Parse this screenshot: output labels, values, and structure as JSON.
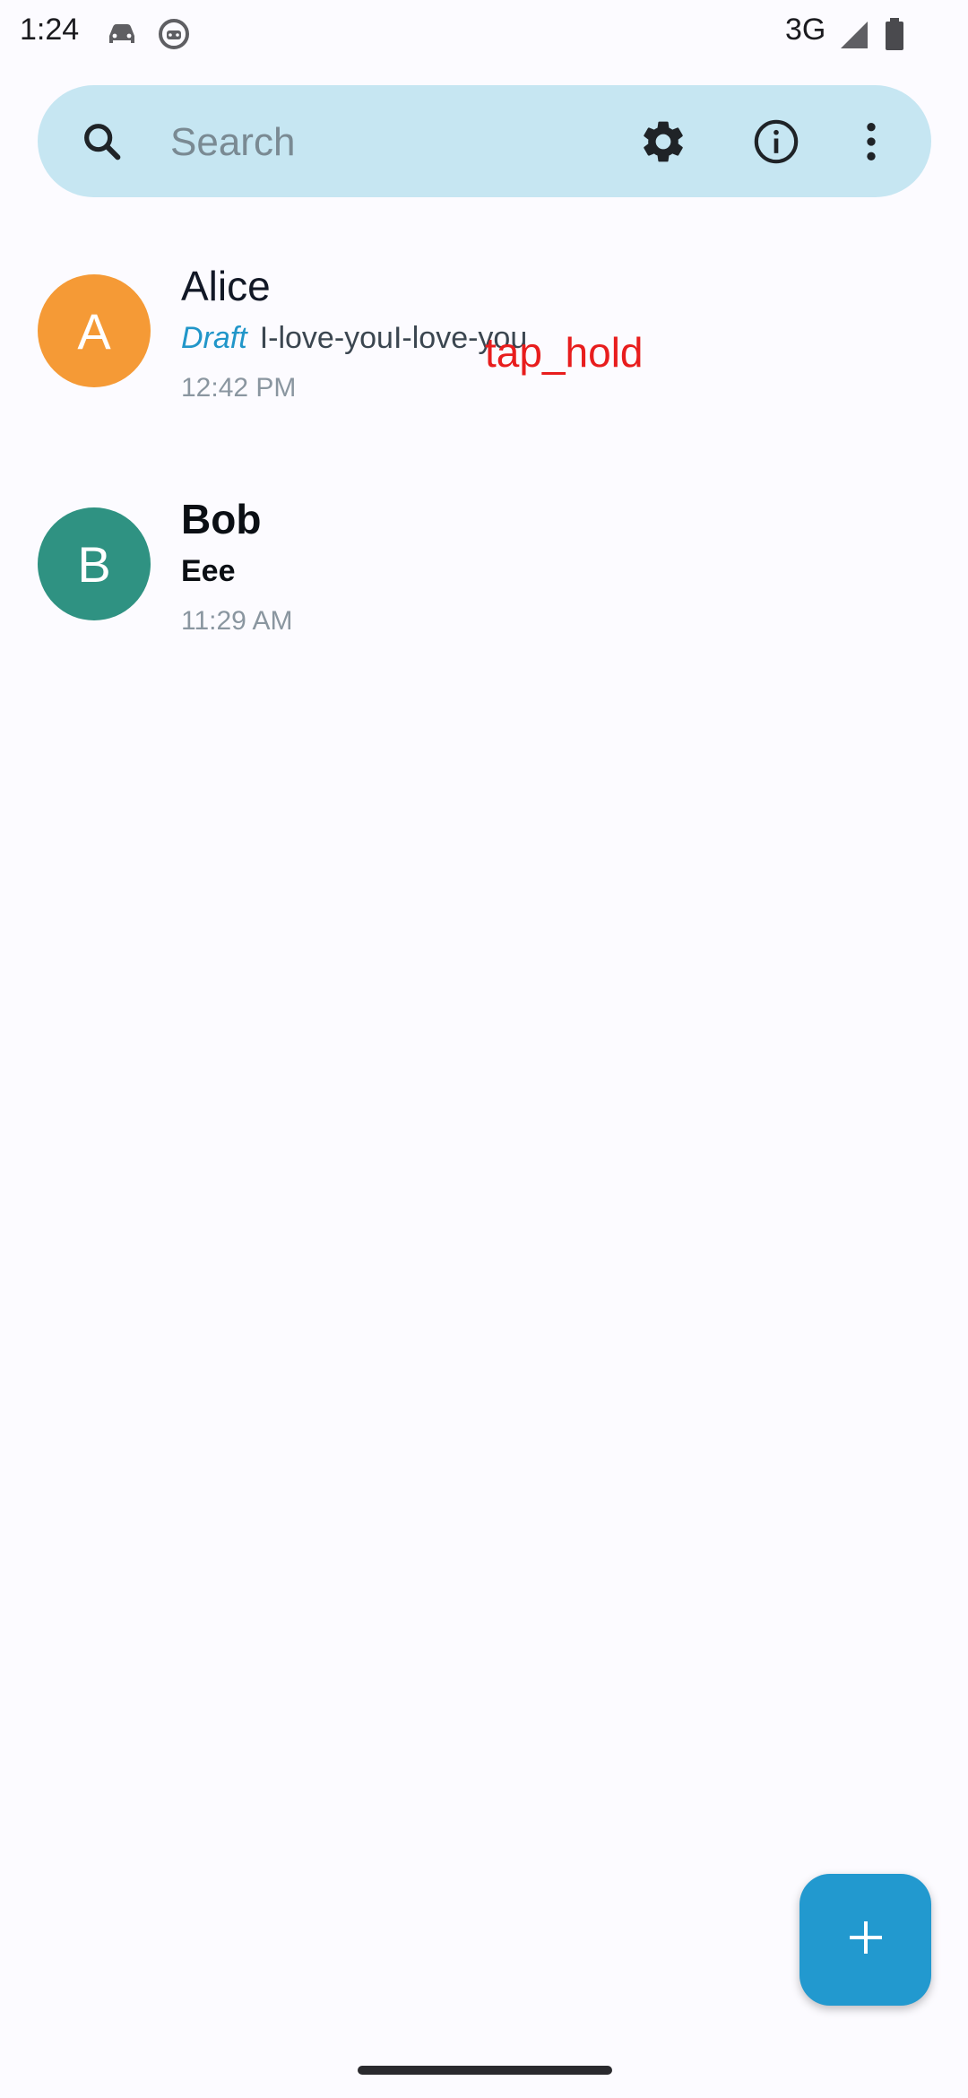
{
  "status_bar": {
    "time": "1:24",
    "network": "3G",
    "icons": [
      "car-icon",
      "android-icon",
      "signal-icon",
      "battery-icon"
    ]
  },
  "search": {
    "placeholder": "Search",
    "icons": [
      "search-icon",
      "settings-gear-icon",
      "info-icon",
      "more-vert-icon"
    ]
  },
  "conversations": [
    {
      "avatar_letter": "A",
      "avatar_color": "#f59a36",
      "name": "Alice",
      "draft_label": "Draft",
      "snippet": "I-love-youI-love-you",
      "time": "12:42 PM",
      "unread": false
    },
    {
      "avatar_letter": "B",
      "avatar_color": "#2f9282",
      "name": "Bob",
      "snippet": "Eee",
      "time": "11:29 AM",
      "unread": true
    }
  ],
  "overlay": {
    "action_label": "tap_hold"
  },
  "fab": {
    "icon": "plus-icon"
  },
  "colors": {
    "background": "#fcfbff",
    "search_bar": "#c6e6f2",
    "accent": "#2299cf",
    "overlay_text": "#e81d1d"
  }
}
